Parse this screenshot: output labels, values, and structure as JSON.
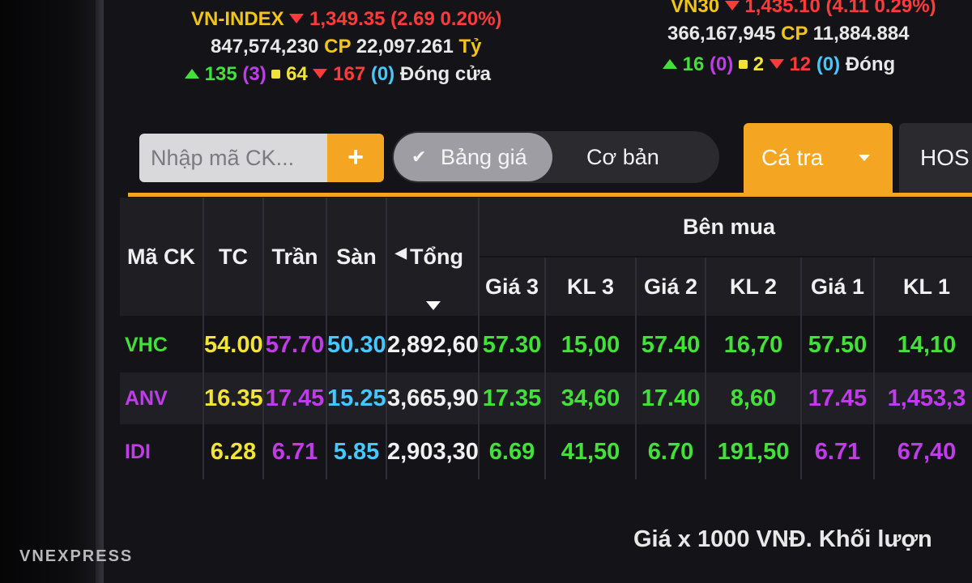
{
  "vnindex": {
    "name": "VN-INDEX",
    "value": "1,349.35",
    "change": "(2.69 0.20%)",
    "volume": "847,574,230",
    "volume_unit": "CP",
    "turnover": "22,097.261",
    "turnover_unit": "Tỷ",
    "advances": "135",
    "ceiling": "(3)",
    "unchanged": "64",
    "declines": "167",
    "floor": "(0)",
    "status": "Đóng cửa"
  },
  "vn30": {
    "name": "VN30",
    "value": "1,435.10",
    "change": "(4.11 0.29%)",
    "volume": "366,167,945",
    "volume_unit": "CP",
    "turnover": "11,884.884",
    "advances": "16",
    "ceiling": "(0)",
    "unchanged": "2",
    "declines": "12",
    "floor": "(0)",
    "status": "Đóng"
  },
  "toolbar": {
    "search_placeholder": "Nhập mã CK...",
    "add_label": "+",
    "view_active": "Bảng giá",
    "view_other": "Cơ bản",
    "tab_active": "Cá tra",
    "tab_next": "HOS"
  },
  "table": {
    "headers": {
      "symbol": "Mã CK",
      "ref": "TC",
      "ceil": "Trần",
      "floor": "Sàn",
      "total": "Tổng",
      "buy_side": "Bên mua",
      "p3": "Giá 3",
      "v3": "KL 3",
      "p2": "Giá 2",
      "v2": "KL 2",
      "p1": "Giá 1",
      "v1": "KL 1"
    },
    "rows": [
      {
        "symbol": "VHC",
        "ref": "54.00",
        "ceil": "57.70",
        "floor": "50.30",
        "total": "2,892,60",
        "p3": "57.30",
        "v3": "15,00",
        "p2": "57.40",
        "v2": "16,70",
        "p1": "57.50",
        "v1": "14,10"
      },
      {
        "symbol": "ANV",
        "ref": "16.35",
        "ceil": "17.45",
        "floor": "15.25",
        "total": "3,665,90",
        "p3": "17.35",
        "v3": "34,60",
        "p2": "17.40",
        "v2": "8,60",
        "p1": "17.45",
        "v1": "1,453,3"
      },
      {
        "symbol": "IDI",
        "ref": "6.28",
        "ceil": "6.71",
        "floor": "5.85",
        "total": "2,903,30",
        "p3": "6.69",
        "v3": "41,50",
        "p2": "6.70",
        "v2": "191,50",
        "p1": "6.71",
        "v1": "67,40"
      }
    ]
  },
  "footer_note": "Giá x 1000 VNĐ. Khối lượn",
  "watermark": "VNEXPRESS",
  "colors": {
    "accent": "#f4a623",
    "up": "#44e03a",
    "down": "#ff3b3b",
    "ceiling": "#c03ce8",
    "floor": "#45c8ff",
    "ref": "#f2e33a"
  }
}
